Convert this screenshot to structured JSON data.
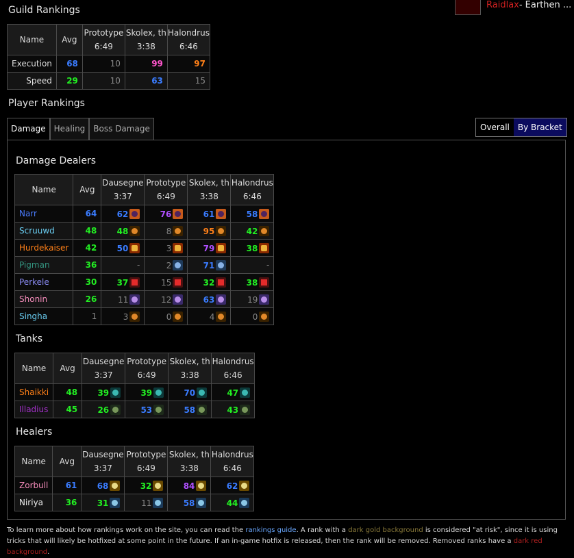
{
  "user": {
    "name": "Raidlax",
    "realm": " - Earthen ..."
  },
  "guild_rankings": {
    "title": "Guild Rankings",
    "headers": [
      "Name",
      "Avg",
      "Prototype",
      "Skolex, th",
      "Halondrus"
    ],
    "times": [
      "6:49",
      "3:38",
      "6:46"
    ],
    "rows": [
      {
        "name": "Execution",
        "avg": "68",
        "v": [
          "10",
          "99",
          "97"
        ]
      },
      {
        "name": "Speed",
        "avg": "29",
        "v": [
          "10",
          "63",
          "15"
        ]
      }
    ]
  },
  "player_rankings": {
    "title": "Player Rankings"
  },
  "tabs": [
    "Damage",
    "Healing",
    "Boss Damage"
  ],
  "toggle": [
    "Overall",
    "By Bracket"
  ],
  "boss_headers": [
    "Name",
    "Avg",
    "Dausegne",
    "Prototype",
    "Skolex, th",
    "Halondrus"
  ],
  "boss_times": [
    "3:37",
    "6:49",
    "3:38",
    "6:46"
  ],
  "dps": {
    "title": "Damage Dealers",
    "rows": [
      {
        "name": "Narr",
        "avg": "64",
        "v": [
          "62",
          "76",
          "61",
          "58"
        ]
      },
      {
        "name": "Scruuwd",
        "avg": "48",
        "v": [
          "48",
          "8",
          "95",
          "42"
        ]
      },
      {
        "name": "Hurdekaiser",
        "avg": "42",
        "v": [
          "50",
          "3",
          "79",
          "38"
        ]
      },
      {
        "name": "Pigman",
        "avg": "36",
        "v": [
          "-",
          "2",
          "71",
          "-"
        ]
      },
      {
        "name": "Perkele",
        "avg": "30",
        "v": [
          "37",
          "15",
          "32",
          "38"
        ]
      },
      {
        "name": "Shonin",
        "avg": "26",
        "v": [
          "11",
          "12",
          "63",
          "19"
        ]
      },
      {
        "name": "Singha",
        "avg": "1",
        "v": [
          "3",
          "0",
          "4",
          "0"
        ]
      }
    ]
  },
  "tanks": {
    "title": "Tanks",
    "rows": [
      {
        "name": "Shaikki",
        "avg": "48",
        "v": [
          "39",
          "39",
          "70",
          "47"
        ]
      },
      {
        "name": "Illadius",
        "avg": "45",
        "v": [
          "26",
          "53",
          "58",
          "43"
        ]
      }
    ]
  },
  "healers": {
    "title": "Healers",
    "rows": [
      {
        "name": "Zorbull",
        "avg": "61",
        "v": [
          "68",
          "32",
          "84",
          "62"
        ]
      },
      {
        "name": "Niriya",
        "avg": "36",
        "v": [
          "31",
          "11",
          "58",
          "44"
        ]
      }
    ]
  },
  "footer": {
    "t1": "To learn more about how rankings work on the site, you can read the ",
    "link": "rankings guide",
    "t2": ". A rank with a ",
    "gold": "dark gold background",
    "t3": " is considered \"at risk\", since it is using tricks that will likely be hotfixed at some point in the future. If an in-game hotfix is released, then the rank will be removed. Removed ranks have a ",
    "red": "dark red background",
    "t4": "."
  }
}
